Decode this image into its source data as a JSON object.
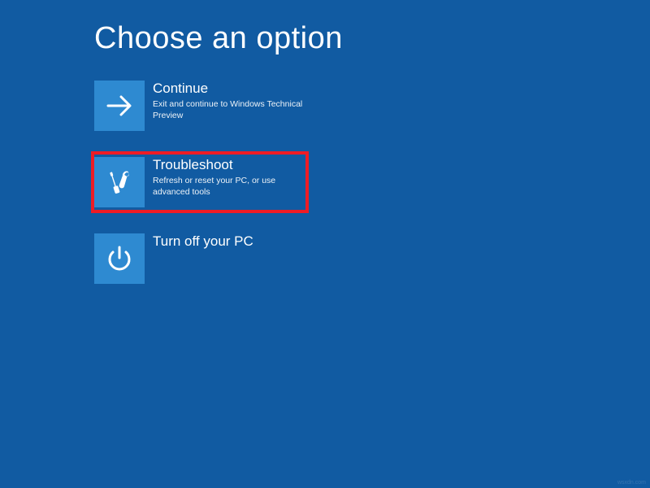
{
  "title": "Choose an option",
  "options": {
    "continue": {
      "title": "Continue",
      "desc": "Exit and continue to Windows Technical Preview"
    },
    "troubleshoot": {
      "title": "Troubleshoot",
      "desc": "Refresh or reset your PC, or use advanced tools"
    },
    "turnoff": {
      "title": "Turn off your PC",
      "desc": ""
    }
  },
  "watermark": "wsxdn.com",
  "colors": {
    "background": "#115ba2",
    "tile": "#2e8ad1",
    "highlight": "#ee1c25"
  }
}
